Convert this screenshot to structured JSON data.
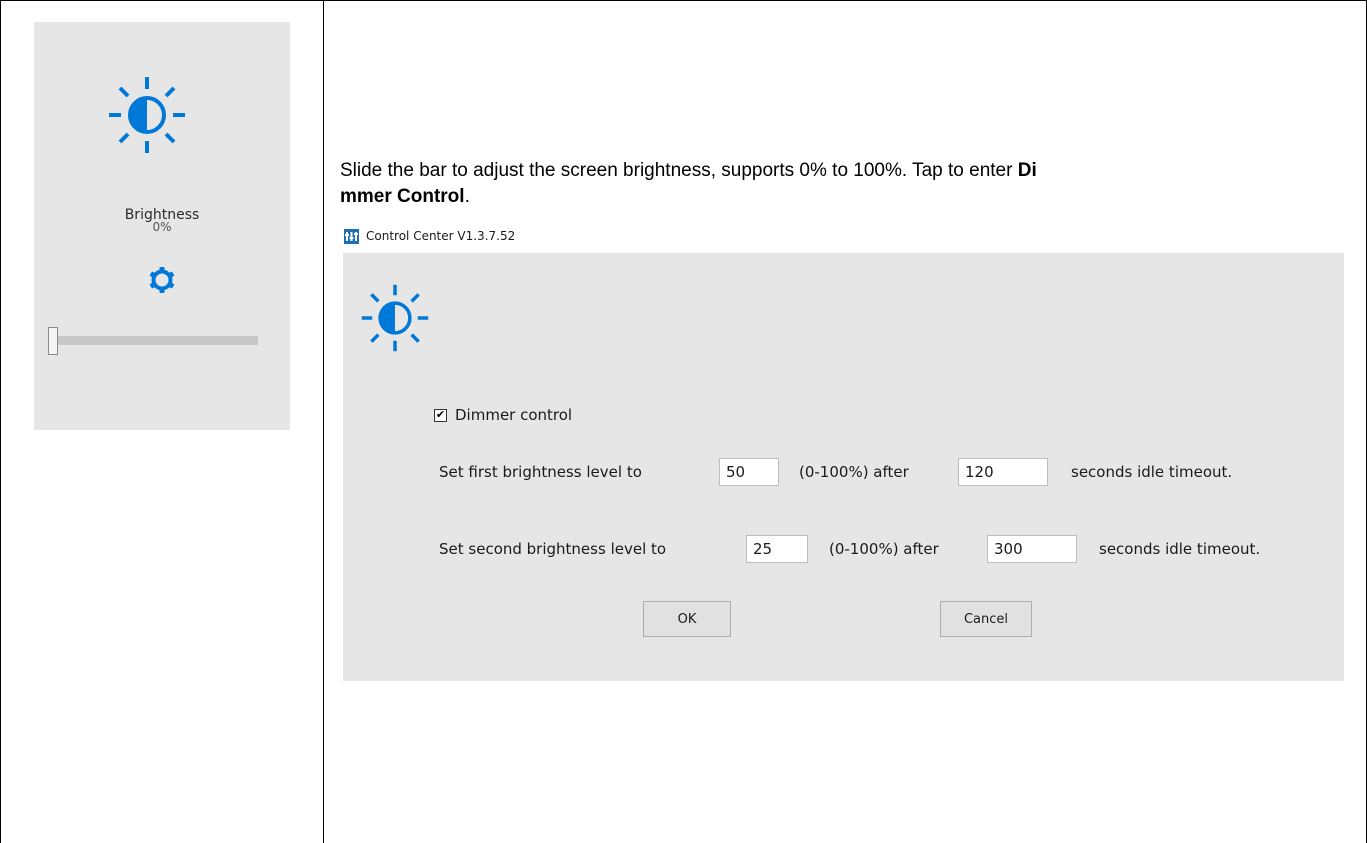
{
  "tile": {
    "icon": "brightness-icon",
    "label": "Brightness",
    "value": "0%",
    "settings_icon": "gear-icon",
    "slider_level": 0
  },
  "description": {
    "line1_text": "Slide the bar to adjust the screen brightness, supports 0% to 100%. Tap   to enter ",
    "line1_bold": "Di",
    "line2_bold": "mmer Control",
    "line2_text": "."
  },
  "dialog": {
    "title": "Control Center V1.3.7.52",
    "checkbox_label": "Dimmer control",
    "checkbox_checked": true,
    "row1": {
      "prefix": "Set first brightness level to",
      "level": "50",
      "range": "(0-100%) after",
      "seconds": "120",
      "suffix": "seconds idle timeout."
    },
    "row2": {
      "prefix": "Set second brightness level to",
      "level": "25",
      "range": "(0-100%) after",
      "seconds": "300",
      "suffix": "seconds idle timeout."
    },
    "ok_label": "OK",
    "cancel_label": "Cancel"
  },
  "colors": {
    "accent": "#0078d7",
    "panel_bg": "#e6e6e6"
  }
}
